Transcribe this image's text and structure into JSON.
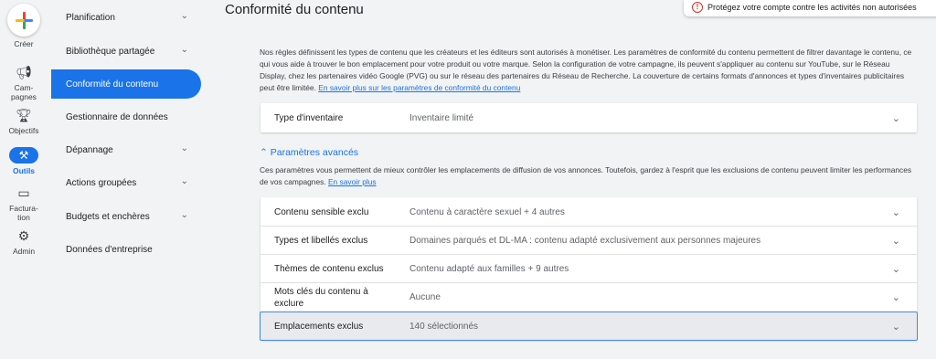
{
  "rail": {
    "create": "Créer",
    "campaigns": "Cam-\npagnes",
    "objectives": "Objectifs",
    "tools": "Outils",
    "billing": "Factura-\ntion",
    "admin": "Admin"
  },
  "nav": {
    "items": [
      {
        "label": "Planification",
        "chevron": true
      },
      {
        "label": "Bibliothèque partagée",
        "chevron": true
      },
      {
        "label": "Conformité du contenu",
        "chevron": false,
        "active": true
      },
      {
        "label": "Gestionnaire de données",
        "chevron": false
      },
      {
        "label": "Dépannage",
        "chevron": true
      },
      {
        "label": "Actions groupées",
        "chevron": true
      },
      {
        "label": "Budgets et enchères",
        "chevron": true
      },
      {
        "label": "Données d'entreprise",
        "chevron": false
      }
    ]
  },
  "header": {
    "title": "Conformité du contenu",
    "alert": "Protégez votre compte contre les activités non autorisées"
  },
  "intro": {
    "text": "Nos règles définissent les types de contenu que les créateurs et les éditeurs sont autorisés à monétiser. Les paramètres de conformité du contenu permettent de filtrer davantage le contenu, ce qui vous aide à trouver le bon emplacement pour votre produit ou votre marque. Selon la configuration de votre campagne, ils peuvent s'appliquer au contenu sur YouTube, sur le Réseau Display, chez les partenaires vidéo Google (PVG) ou sur le réseau des partenaires du Réseau de Recherche. La couverture de certains formats d'annonces et types d'inventaires publicitaires peut être limitée.",
    "link": "En savoir plus sur les paramètres de conformité du contenu"
  },
  "inventory": {
    "label": "Type d'inventaire",
    "value": "Inventaire limité"
  },
  "advanced": {
    "toggle": "Paramètres avancés",
    "desc": "Ces paramètres vous permettent de mieux contrôler les emplacements de diffusion de vos annonces. Toutefois, gardez à l'esprit que les exclusions de contenu peuvent limiter les performances de vos campagnes.",
    "link": "En savoir plus",
    "rows": [
      {
        "label": "Contenu sensible exclu",
        "value": "Contenu à caractère sexuel + 4 autres"
      },
      {
        "label": "Types et libellés exclus",
        "value": "Domaines parqués et DL-MA : contenu adapté exclusivement aux personnes majeures"
      },
      {
        "label": "Thèmes de contenu exclus",
        "value": "Contenu adapté aux familles + 9 autres"
      },
      {
        "label": "Mots clés du contenu à exclure",
        "value": "Aucune"
      },
      {
        "label": "Emplacements exclus",
        "value": "140 sélectionnés"
      }
    ]
  },
  "colors": {
    "accent": "#1a73e8",
    "alert": "#d93025"
  }
}
